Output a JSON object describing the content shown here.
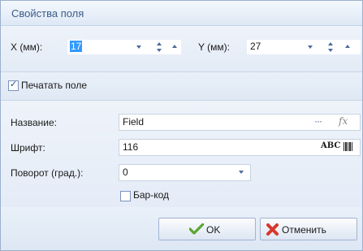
{
  "dialog": {
    "title": "Свойства поля"
  },
  "coords": {
    "x_label": "X (мм):",
    "x_value": "17",
    "y_label": "Y (мм):",
    "y_value": "27"
  },
  "print_field": {
    "label": "Печатать поле",
    "checked": true
  },
  "name": {
    "label": "Название:",
    "value": "Field",
    "ellipsis": "···",
    "fx": "fx"
  },
  "font": {
    "label": "Шрифт:",
    "value": "116",
    "abc": "ABC"
  },
  "rotation": {
    "label": "Поворот (град.):",
    "value": "0"
  },
  "barcode": {
    "label": "Бар-код",
    "checked": false
  },
  "buttons": {
    "ok": "OK",
    "cancel": "Отменить"
  },
  "colors": {
    "accent": "#3d5c8a",
    "selection": "#3399ff",
    "ok_icon": "#5aa630",
    "cancel_icon": "#d9362b"
  }
}
